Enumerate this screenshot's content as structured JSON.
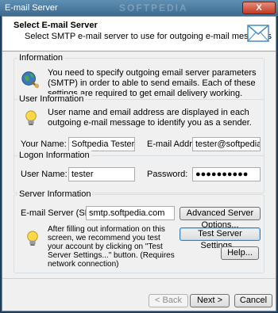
{
  "window": {
    "title": "E-mail Server",
    "watermark": "SOFTPEDIA",
    "close_label": "X"
  },
  "header": {
    "title": "Select E-mail Server",
    "subtitle": "Select SMTP e-mail server to use for outgoing e-mail messages",
    "icon": "envelope-icon"
  },
  "info_group": {
    "label": "Information",
    "text": "You need to specify outgoing email server parameters (SMTP) in order to able to send emails. Each of these settings are required to get email delivery working.",
    "icon": "globe-icon"
  },
  "user_group": {
    "label": "User Information",
    "text": "User name and email address are displayed in each outgoing e-mail message to identify you as a sender.",
    "icon": "lightbulb-icon",
    "your_name_label": "Your Name:",
    "your_name_value": "Softpedia Tester",
    "email_label": "E-mail Address:",
    "email_value": "tester@softpedia.com"
  },
  "logon_group": {
    "label": "Logon Information",
    "user_name_label": "User Name:",
    "user_name_value": "tester",
    "password_label": "Password:",
    "password_value": "●●●●●●●●●●"
  },
  "server_group": {
    "label": "Server Information",
    "smtp_label": "E-mail Server (SMTP):",
    "smtp_value": "smtp.softpedia.com",
    "advanced_button": "Advanced Server Options...",
    "test_text": "After filling out information on this screen, we recommend you test your account by clicking on \"Test Server Settings...\" button. (Requires network connection)",
    "test_button": "Test Server Settings...",
    "help_button": "Help...",
    "icon": "lightbulb-icon"
  },
  "footer": {
    "back_button": "< Back",
    "next_button": "Next >",
    "cancel_button": "Cancel"
  },
  "colors": {
    "accent": "#3c7fb1",
    "titlebar": "#3c6b90",
    "close": "#c23b22"
  }
}
